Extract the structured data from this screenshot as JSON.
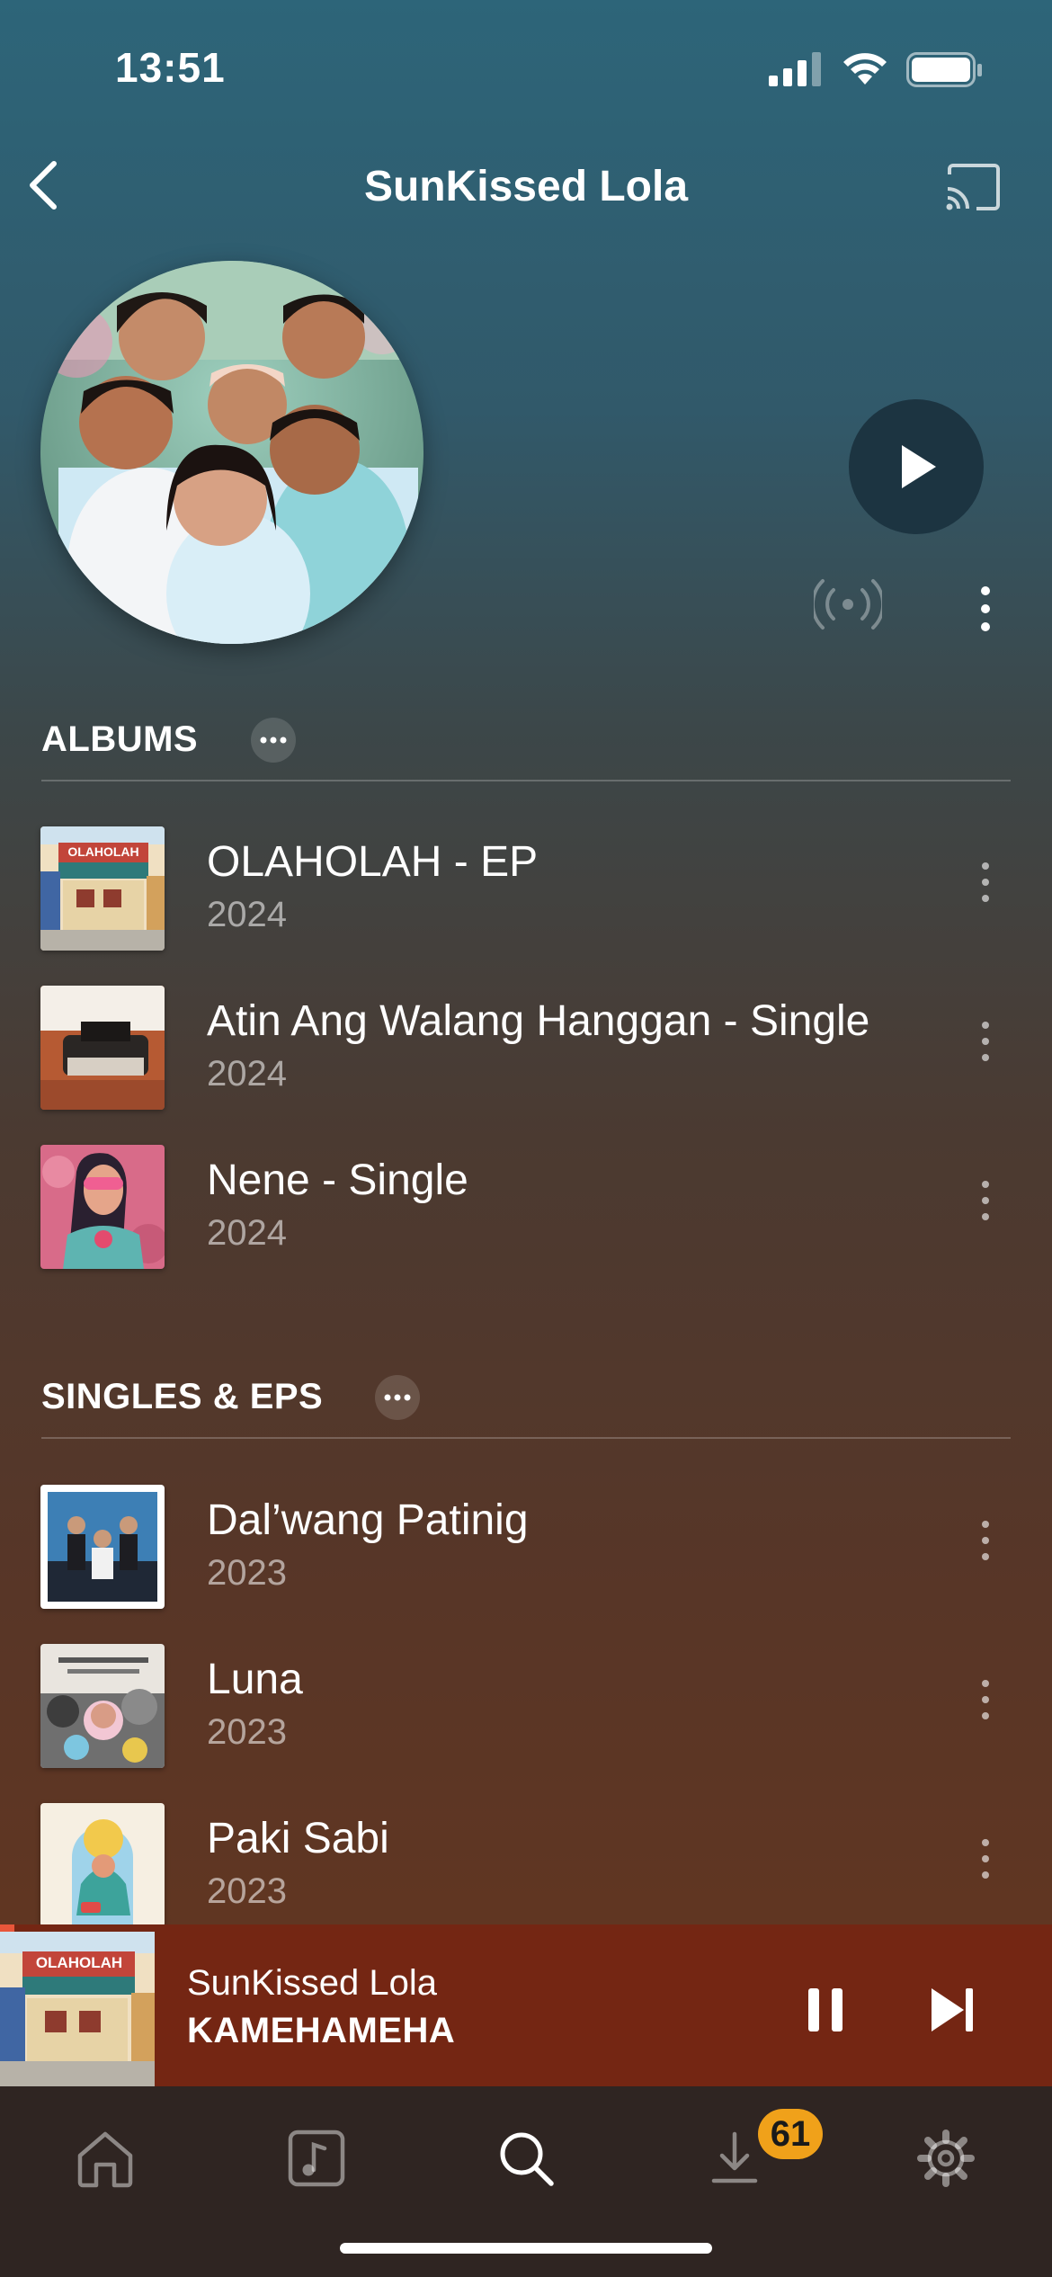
{
  "status_bar": {
    "time": "13:51"
  },
  "nav": {
    "title": "SunKissed Lola"
  },
  "albums": {
    "title": "ALBUMS",
    "items": [
      {
        "title": "OLAHOLAH - EP",
        "year": "2024",
        "art_text": "OLAHOLAH"
      },
      {
        "title": "Atin Ang Walang Hanggan - Single",
        "year": "2024"
      },
      {
        "title": "Nene - Single",
        "year": "2024"
      }
    ]
  },
  "singles": {
    "title": "SINGLES & EPS",
    "items": [
      {
        "title": "Dal’wang Patinig",
        "year": "2023"
      },
      {
        "title": "Luna",
        "year": "2023"
      },
      {
        "title": "Paki Sabi",
        "year": "2023"
      }
    ]
  },
  "now_playing": {
    "artist": "SunKissed Lola",
    "song": "KAMEHAMEHA",
    "art_text": "OLAHOLAH"
  },
  "tab_bar": {
    "downloads_badge": "61"
  },
  "colors": {
    "accent": "#f0a11a",
    "mini_player": "#742613",
    "tab_bar": "#2f2522"
  }
}
